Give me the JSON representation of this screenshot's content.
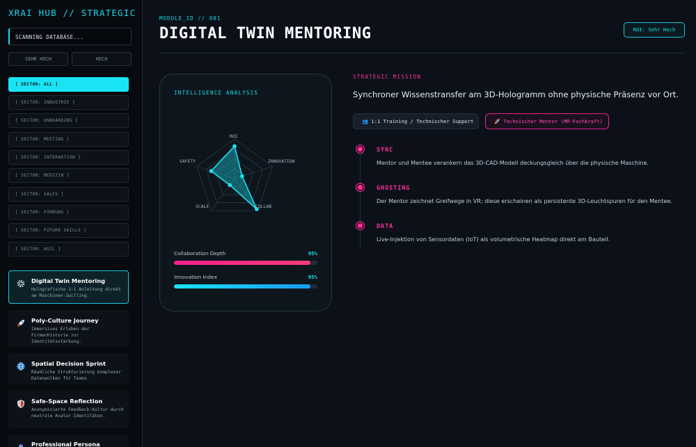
{
  "sidebar": {
    "brand": "XRAI HUB // STRATEGIC",
    "search_text": "SCANNING DATABASE...",
    "filters": [
      "SEHR HOCH",
      "HOCH"
    ],
    "sectors": [
      "[ SECTOR: ALL ]",
      "[ SECTOR: INDUSTRIE ]",
      "[ SECTOR: ONBOARDING ]",
      "[ SECTOR: MEETING ]",
      "[ SECTOR: INTERAKTION ]",
      "[ SECTOR: MEDIZIN ]",
      "[ SECTOR: SALES ]",
      "[ SECTOR: FÜHRUNG ]",
      "[ SECTOR: FUTURE SKILLS ]",
      "[ SECTOR: AGIL ]"
    ],
    "modules": [
      {
        "title": "Digital Twin Mentoring",
        "desc": "Holografische 1:1 Anleitung direkt am Maschinen-Zwilling.",
        "icon": "gear-icon"
      },
      {
        "title": "Poly-Culture Journey",
        "desc": "Immersives Erleben der Firmenhistorie zur Identitätsstärkung.",
        "icon": "rocket-icon"
      },
      {
        "title": "Spatial Decision Sprint",
        "desc": "Räumliche Strukturierung komplexer Datenwolken für Teams.",
        "icon": "globe-icon"
      },
      {
        "title": "Safe-Space Reflection",
        "desc": "Anonymisierte Feedback-Kultur durch neutrale Avatar-Identitäten.",
        "icon": "shield-icon"
      },
      {
        "title": "Professional Persona",
        "desc": "",
        "icon": "persona-icon"
      }
    ]
  },
  "header": {
    "module_id": "MODULE_ID // 001",
    "title": "DIGITAL TWIN MENTORING",
    "roi_badge": "ROI: Sehr Hoch"
  },
  "analysis": {
    "title": "INTELLIGENCE ANALYSIS",
    "radar": {
      "axes": [
        "ROI",
        "INNOVATION",
        "COLLAB",
        "SCALE",
        "SAFETY"
      ],
      "values": [
        0.82,
        0.2,
        0.95,
        0.2,
        0.62
      ],
      "accent": "#18e4f5"
    },
    "metrics": [
      {
        "label": "Collaboration Depth",
        "value": "95%",
        "fraction": 0.95,
        "color": "#ff1f8f",
        "color2": "#ff3d7a"
      },
      {
        "label": "Innovation Index",
        "value": "95%",
        "fraction": 0.95,
        "color": "#18e4f5",
        "color2": "#1a9cf2"
      }
    ]
  },
  "mission": {
    "label": "STRATEGIC MISSION",
    "text": "Synchroner Wissenstransfer am 3D-Hologramm ohne physische Präsenz vor Ort.",
    "tags": [
      "👥 1:1 Training / Technischer Support",
      "🚀 Technischer Mentor (MR-Fachkraft)"
    ],
    "steps": [
      {
        "title": "SYNC",
        "text": "Mentor und Mentee verankern das 3D-CAD-Modell deckungsgleich über die physische Maschine."
      },
      {
        "title": "GHOSTING",
        "text": "Der Mentor zeichnet Greifwege in VR; diese erscheinen als persistente 3D-Leuchtspuren für den Mentee."
      },
      {
        "title": "DATA",
        "text": "Live-Injektion von Sensordaten (IoT) als volumetrische Heatmap direkt am Bauteil."
      }
    ]
  }
}
